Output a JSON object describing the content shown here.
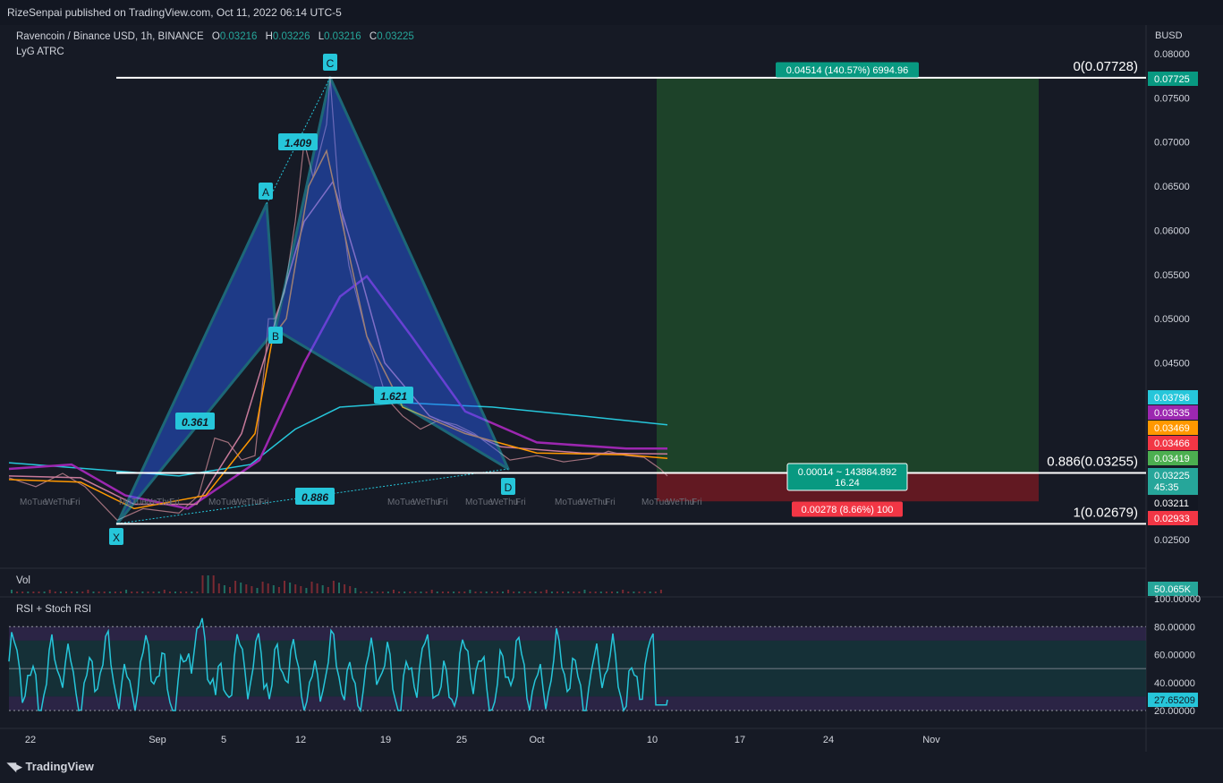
{
  "header": {
    "publisher": "RizeSenpai published on TradingView.com, Oct 11, 2022 06:14 UTC-5"
  },
  "legend": {
    "symbol": "Ravencoin / Binance USD, 1h, BINANCE",
    "ohlc": [
      {
        "k": "O",
        "v": "0.03216"
      },
      {
        "k": "H",
        "v": "0.03226"
      },
      {
        "k": "L",
        "v": "0.03216"
      },
      {
        "k": "C",
        "v": "0.03225"
      }
    ],
    "indicator": "LyG ATRC"
  },
  "panes": {
    "volume": "Vol",
    "rsi": "RSI + Stoch RSI"
  },
  "footer": {
    "brand": "TradingView"
  },
  "chart_data": {
    "type": "line",
    "currency": "BUSD",
    "y_ticks": [
      "0.08000",
      "0.07500",
      "0.07000",
      "0.06500",
      "0.06000",
      "0.05500",
      "0.05000",
      "0.04500",
      "0.02500"
    ],
    "x_ticks": [
      "22",
      "Sep",
      "5",
      "12",
      "19",
      "25",
      "Oct",
      "10",
      "17",
      "24",
      "Nov"
    ],
    "harmonic_pattern": {
      "points": [
        {
          "label": "X",
          "price": 0.0268
        },
        {
          "label": "A",
          "price": 0.063
        },
        {
          "label": "B",
          "price": 0.0488
        },
        {
          "label": "C",
          "price": 0.0773
        },
        {
          "label": "D",
          "price": 0.033
        }
      ],
      "ratios": [
        "0.361",
        "1.409",
        "1.621",
        "0.886"
      ]
    },
    "fib_levels": [
      {
        "label": "0(0.07728)",
        "price": 0.07728
      },
      {
        "label": "0.886(0.03255)",
        "price": 0.03255
      },
      {
        "label": "1(0.02679)",
        "price": 0.02679
      }
    ],
    "position": {
      "target_label": "0.04514 (140.57%) 6994.96",
      "entry_label_1": "0.00014 ~ 143884.892",
      "entry_label_2": "16.24",
      "stop_label": "0.00278 (8.66%) 100"
    },
    "price_tags": [
      {
        "value": "0.07725",
        "price": 0.07725,
        "color": "#089981"
      },
      {
        "value": "0.03796",
        "price": 0.03796,
        "color": "#26c6da"
      },
      {
        "value": "0.03535",
        "price": 0.03535,
        "color": "#9c27b0"
      },
      {
        "value": "0.03469",
        "price": 0.03469,
        "color": "#ff9800"
      },
      {
        "value": "0.03466",
        "price": 0.03466,
        "color": "#f23645"
      },
      {
        "value": "0.03419",
        "price": 0.03419,
        "color": "#4caf50"
      },
      {
        "value": "0.03225",
        "price": 0.03225,
        "color": "#26a69a",
        "sub": "45:35"
      },
      {
        "value": "0.03211",
        "price": 0.03211,
        "color": "#131722"
      },
      {
        "value": "0.02933",
        "price": 0.02933,
        "color": "#f23645"
      }
    ],
    "volume_tag": "50.065K",
    "rsi": {
      "ticks": [
        "100.00000",
        "80.00000",
        "60.00000",
        "40.00000",
        "20.00000"
      ],
      "last": "27.65209",
      "upper_band": 80,
      "lower_band": 20
    },
    "day_labels": [
      "Mo",
      "Tue",
      "We",
      "Thu",
      "Fri"
    ]
  }
}
